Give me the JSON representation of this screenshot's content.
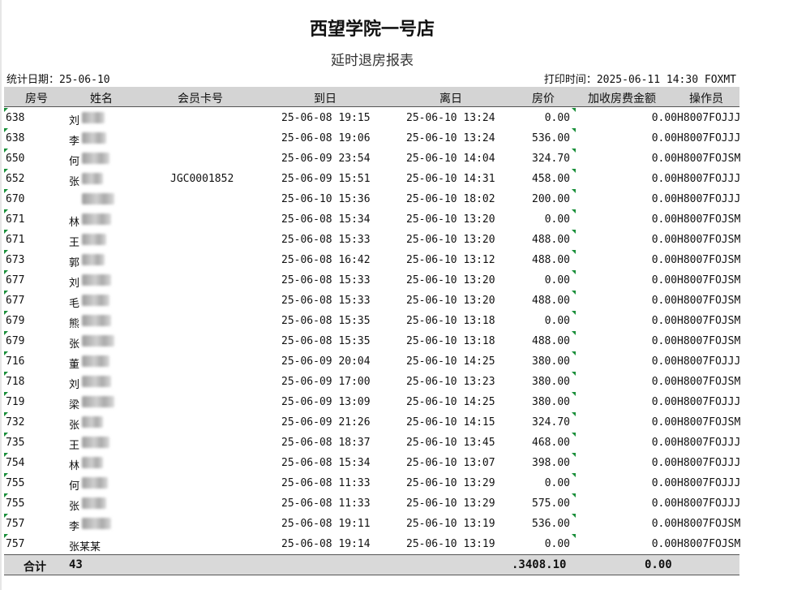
{
  "report": {
    "title": "西望学院一号店",
    "subtitle": "延时退房报表",
    "stat_date": "统计日期：25-06-10",
    "print_time": "打印时间：2025-06-11 14:30 FOXMT"
  },
  "columns": {
    "room": "房号",
    "name": "姓名",
    "card": "会员卡号",
    "arrival": "到日",
    "departure": "离日",
    "price": "房价",
    "extra_fee": "加收房费金额",
    "operator": "操作员"
  },
  "rows": [
    {
      "room": "638",
      "name": "刘",
      "card": "",
      "arrival": "25-06-08 19:15",
      "departure": "25-06-10 13:24",
      "price": "0.00",
      "extra_fee": "0.00",
      "operator": "H8007FOJJJ"
    },
    {
      "room": "638",
      "name": "李",
      "card": "",
      "arrival": "25-06-08 19:06",
      "departure": "25-06-10 13:24",
      "price": "536.00",
      "extra_fee": "0.00",
      "operator": "H8007FOJJJ"
    },
    {
      "room": "650",
      "name": "何",
      "card": "",
      "arrival": "25-06-09 23:54",
      "departure": "25-06-10 14:04",
      "price": "324.70",
      "extra_fee": "0.00",
      "operator": "H8007FOJSM"
    },
    {
      "room": "652",
      "name": "张",
      "card": "JGC0001852",
      "arrival": "25-06-09 15:51",
      "departure": "25-06-10 14:31",
      "price": "458.00",
      "extra_fee": "0.00",
      "operator": "H8007FOJJJ"
    },
    {
      "room": "670",
      "name": "",
      "card": "",
      "arrival": "25-06-10 15:36",
      "departure": "25-06-10 18:02",
      "price": "200.00",
      "extra_fee": "0.00",
      "operator": "H8007FOJJJ"
    },
    {
      "room": "671",
      "name": "林",
      "card": "",
      "arrival": "25-06-08 15:34",
      "departure": "25-06-10 13:20",
      "price": "0.00",
      "extra_fee": "0.00",
      "operator": "H8007FOJSM"
    },
    {
      "room": "671",
      "name": "王",
      "card": "",
      "arrival": "25-06-08 15:33",
      "departure": "25-06-10 13:20",
      "price": "488.00",
      "extra_fee": "0.00",
      "operator": "H8007FOJSM"
    },
    {
      "room": "673",
      "name": "郭",
      "card": "",
      "arrival": "25-06-08 16:42",
      "departure": "25-06-10 13:12",
      "price": "488.00",
      "extra_fee": "0.00",
      "operator": "H8007FOJSM"
    },
    {
      "room": "677",
      "name": "刘",
      "card": "",
      "arrival": "25-06-08 15:33",
      "departure": "25-06-10 13:20",
      "price": "0.00",
      "extra_fee": "0.00",
      "operator": "H8007FOJSM"
    },
    {
      "room": "677",
      "name": "毛",
      "card": "",
      "arrival": "25-06-08 15:33",
      "departure": "25-06-10 13:20",
      "price": "488.00",
      "extra_fee": "0.00",
      "operator": "H8007FOJSM"
    },
    {
      "room": "679",
      "name": "熊",
      "card": "",
      "arrival": "25-06-08 15:35",
      "departure": "25-06-10 13:18",
      "price": "0.00",
      "extra_fee": "0.00",
      "operator": "H8007FOJSM"
    },
    {
      "room": "679",
      "name": "张",
      "card": "",
      "arrival": "25-06-08 15:35",
      "departure": "25-06-10 13:18",
      "price": "488.00",
      "extra_fee": "0.00",
      "operator": "H8007FOJSM"
    },
    {
      "room": "716",
      "name": "董",
      "card": "",
      "arrival": "25-06-09 20:04",
      "departure": "25-06-10 14:25",
      "price": "380.00",
      "extra_fee": "0.00",
      "operator": "H8007FOJJJ"
    },
    {
      "room": "718",
      "name": "刘",
      "card": "",
      "arrival": "25-06-09 17:00",
      "departure": "25-06-10 13:23",
      "price": "380.00",
      "extra_fee": "0.00",
      "operator": "H8007FOJSM"
    },
    {
      "room": "719",
      "name": "梁",
      "card": "",
      "arrival": "25-06-09 13:09",
      "departure": "25-06-10 14:25",
      "price": "380.00",
      "extra_fee": "0.00",
      "operator": "H8007FOJJJ"
    },
    {
      "room": "732",
      "name": "张",
      "card": "",
      "arrival": "25-06-09 21:26",
      "departure": "25-06-10 14:15",
      "price": "324.70",
      "extra_fee": "0.00",
      "operator": "H8007FOJSM"
    },
    {
      "room": "735",
      "name": "王",
      "card": "",
      "arrival": "25-06-08 18:37",
      "departure": "25-06-10 13:45",
      "price": "468.00",
      "extra_fee": "0.00",
      "operator": "H8007FOJJJ"
    },
    {
      "room": "754",
      "name": "林",
      "card": "",
      "arrival": "25-06-08 15:34",
      "departure": "25-06-10 13:07",
      "price": "398.00",
      "extra_fee": "0.00",
      "operator": "H8007FOJJJ"
    },
    {
      "room": "755",
      "name": "何",
      "card": "",
      "arrival": "25-06-08 11:33",
      "departure": "25-06-10 13:29",
      "price": "0.00",
      "extra_fee": "0.00",
      "operator": "H8007FOJJJ"
    },
    {
      "room": "755",
      "name": "张",
      "card": "",
      "arrival": "25-06-08 11:33",
      "departure": "25-06-10 13:29",
      "price": "575.00",
      "extra_fee": "0.00",
      "operator": "H8007FOJJJ"
    },
    {
      "room": "757",
      "name": "李",
      "card": "",
      "arrival": "25-06-08 19:11",
      "departure": "25-06-10 13:19",
      "price": "536.00",
      "extra_fee": "0.00",
      "operator": "H8007FOJSM"
    },
    {
      "room": "757",
      "name": "张某某",
      "card": "",
      "arrival": "25-06-08 19:14",
      "departure": "25-06-10 13:19",
      "price": "0.00",
      "extra_fee": "0.00",
      "operator": "H8007FOJSM"
    }
  ],
  "totals": {
    "label": "合计",
    "count": "43",
    "price_sum": ".3408.10",
    "extra_sum": "0.00"
  }
}
